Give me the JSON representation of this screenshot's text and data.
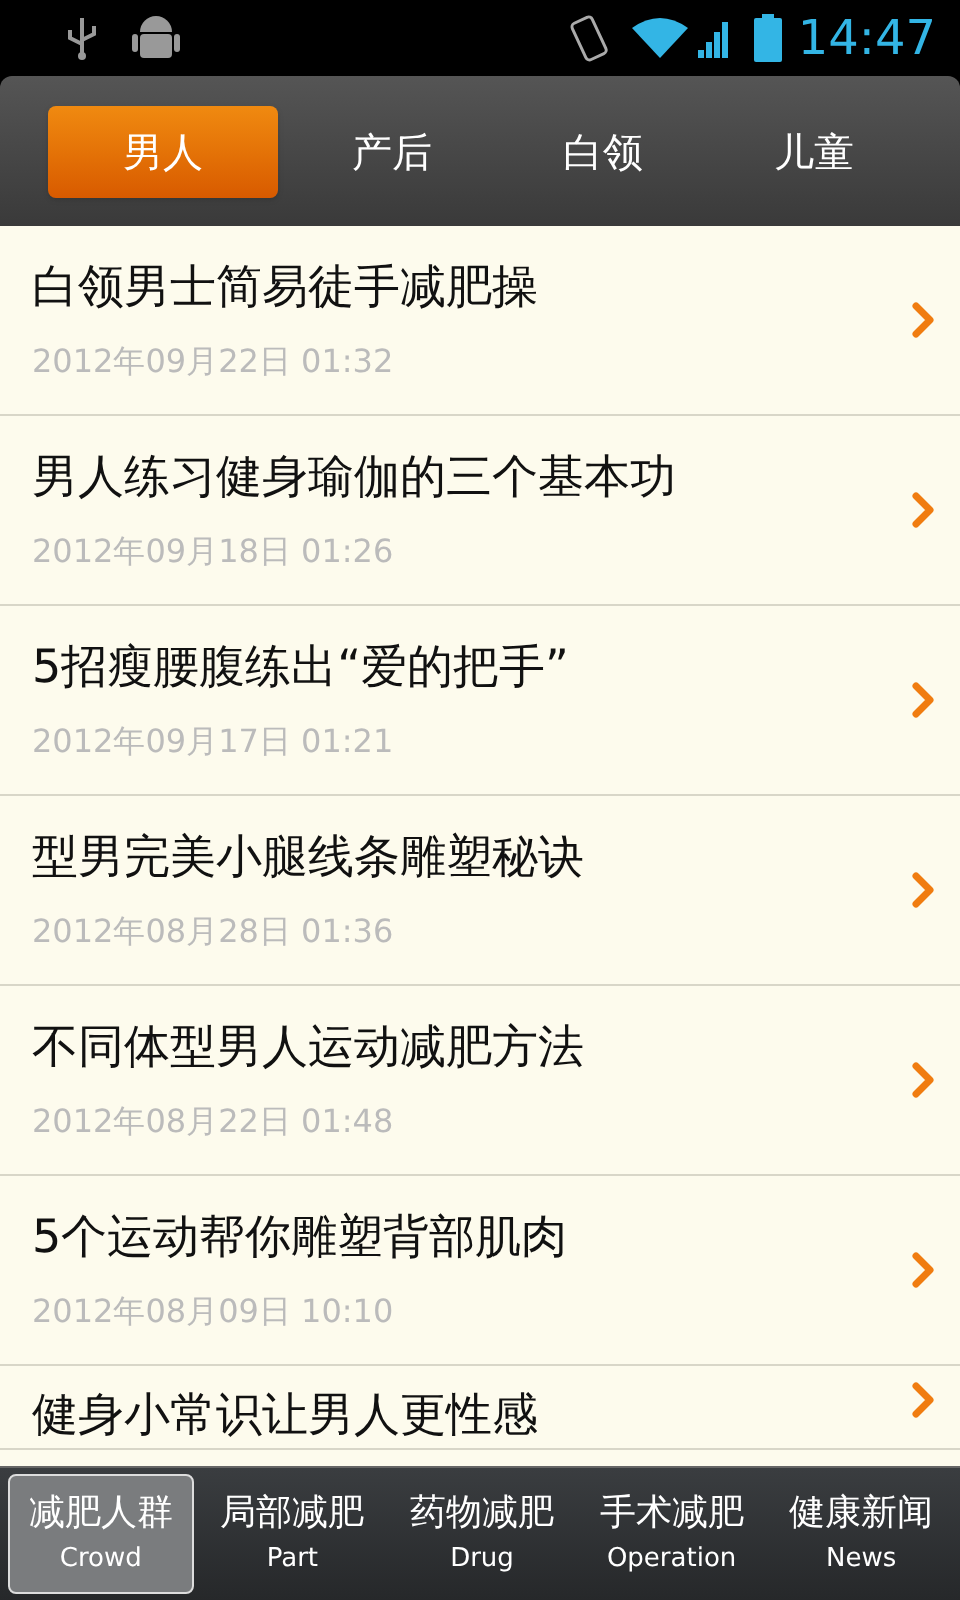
{
  "status_bar": {
    "time": "14:47"
  },
  "tabs": [
    {
      "label": "男人",
      "selected": true
    },
    {
      "label": "产后",
      "selected": false
    },
    {
      "label": "白领",
      "selected": false
    },
    {
      "label": "儿童",
      "selected": false
    }
  ],
  "articles": [
    {
      "title": "白领男士简易徒手减肥操",
      "date": "2012年09月22日 01:32"
    },
    {
      "title": "男人练习健身瑜伽的三个基本功",
      "date": "2012年09月18日 01:26"
    },
    {
      "title": "5招瘦腰腹练出“爱的把手”",
      "date": "2012年09月17日 01:21"
    },
    {
      "title": "型男完美小腿线条雕塑秘诀",
      "date": "2012年08月28日 01:36"
    },
    {
      "title": "不同体型男人运动减肥方法",
      "date": "2012年08月22日 01:48"
    },
    {
      "title": "5个运动帮你雕塑背部肌肉",
      "date": "2012年08月09日 10:10"
    },
    {
      "title": "健身小常识让男人更性感"
    }
  ],
  "bottom_nav": [
    {
      "label": "减肥人群",
      "sublabel": "Crowd",
      "selected": true
    },
    {
      "label": "局部减肥",
      "sublabel": "Part",
      "selected": false
    },
    {
      "label": "药物减肥",
      "sublabel": "Drug",
      "selected": false
    },
    {
      "label": "手术减肥",
      "sublabel": "Operation",
      "selected": false
    },
    {
      "label": "健康新闻",
      "sublabel": "News",
      "selected": false
    }
  ]
}
